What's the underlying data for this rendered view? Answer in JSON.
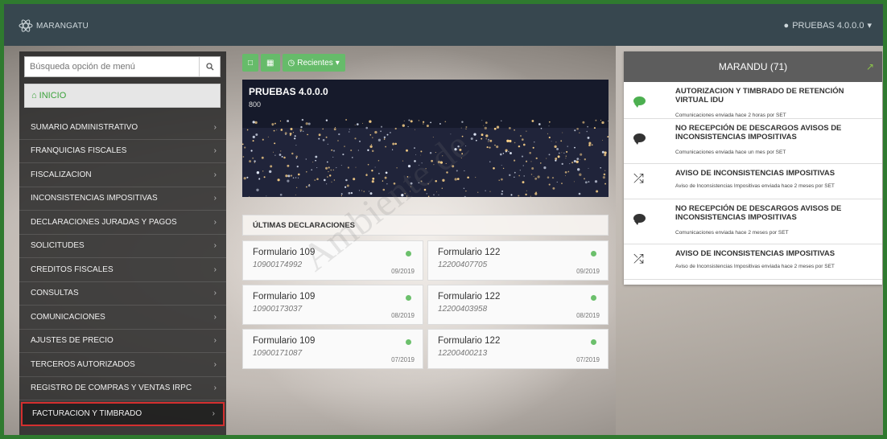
{
  "header": {
    "brand": "MARANGATU",
    "user": "PRUEBAS 4.0.0.0"
  },
  "sidebar": {
    "search_placeholder": "Búsqueda opción de menú",
    "home_label": "INICIO",
    "items": [
      {
        "label": "SUMARIO ADMINISTRATIVO"
      },
      {
        "label": "FRANQUICIAS FISCALES"
      },
      {
        "label": "FISCALIZACION"
      },
      {
        "label": "INCONSISTENCIAS IMPOSITIVAS"
      },
      {
        "label": "DECLARACIONES JURADAS Y PAGOS"
      },
      {
        "label": "SOLICITUDES"
      },
      {
        "label": "CREDITOS FISCALES"
      },
      {
        "label": "CONSULTAS"
      },
      {
        "label": "COMUNICACIONES"
      },
      {
        "label": "AJUSTES DE PRECIO"
      },
      {
        "label": "TERCEROS AUTORIZADOS"
      },
      {
        "label": "REGISTRO DE COMPRAS Y VENTAS IRPC"
      },
      {
        "label": "FACTURACION Y TIMBRADO"
      }
    ]
  },
  "toolbar": {
    "recent_label": "Recientes"
  },
  "hero": {
    "title": "PRUEBAS 4.0.0.0",
    "subtitle": "800"
  },
  "declarations": {
    "heading": "ÚLTIMAS DECLARACIONES",
    "cards": [
      {
        "form": "Formulario 109",
        "number": "10900174992",
        "date": "09/2019"
      },
      {
        "form": "Formulario 122",
        "number": "12200407705",
        "date": "09/2019"
      },
      {
        "form": "Formulario 109",
        "number": "10900173037",
        "date": "08/2019"
      },
      {
        "form": "Formulario 122",
        "number": "12200403958",
        "date": "08/2019"
      },
      {
        "form": "Formulario 109",
        "number": "10900171087",
        "date": "07/2019"
      },
      {
        "form": "Formulario 122",
        "number": "12200400213",
        "date": "07/2019"
      }
    ]
  },
  "panel": {
    "title": "MARANDU (71)",
    "items": [
      {
        "icon": "chat-icon",
        "title": "AUTORIZACION Y TIMBRADO DE RETENCIÓN VIRTUAL IDU",
        "meta": "Comunicaciones enviada hace 2 horas por SET",
        "color": "#4caf50"
      },
      {
        "icon": "chat-icon",
        "title": "NO RECEPCIÓN DE DESCARGOS AVISOS DE INCONSISTENCIAS IMPOSITIVAS",
        "meta": "Comunicaciones enviada hace un mes por SET",
        "color": "#333333"
      },
      {
        "icon": "shuffle-icon",
        "title": "AVISO DE INCONSISTENCIAS IMPOSITIVAS",
        "meta": "Aviso de Inconsistencias Impositivas enviada hace 2 meses por SET",
        "color": "#333333"
      },
      {
        "icon": "chat-icon",
        "title": "NO RECEPCIÓN DE DESCARGOS AVISOS DE INCONSISTENCIAS IMPOSITIVAS",
        "meta": "Comunicaciones enviada hace 2 meses por SET",
        "color": "#333333"
      },
      {
        "icon": "shuffle-icon",
        "title": "AVISO DE INCONSISTENCIAS IMPOSITIVAS",
        "meta": "Aviso de Inconsistencias Impositivas enviada hace 2 meses por SET",
        "color": "#333333"
      }
    ]
  },
  "watermark": "Ambiente de"
}
